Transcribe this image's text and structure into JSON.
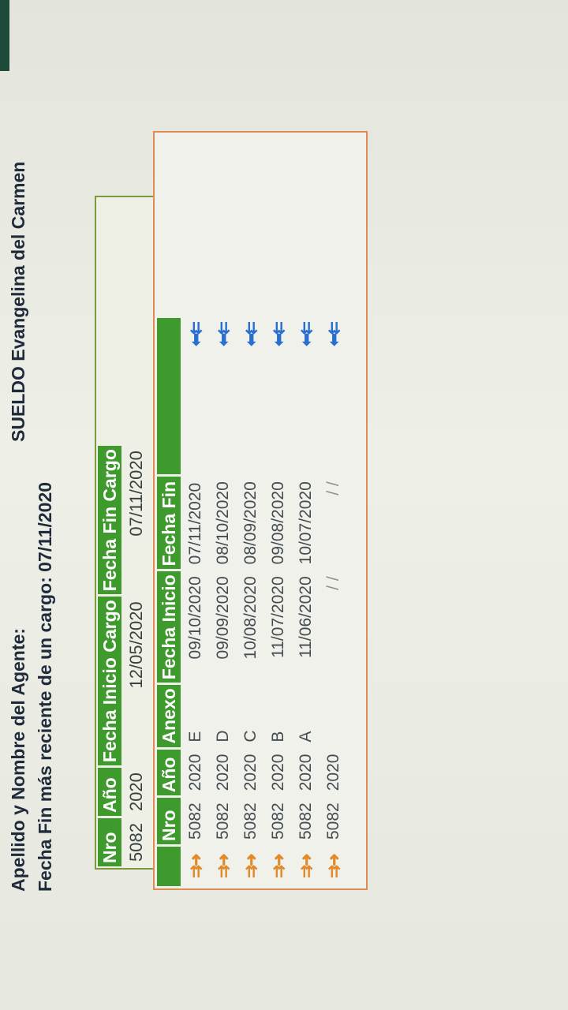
{
  "agent": {
    "name_label": "Apellido y Nombre del Agente:",
    "name_value": "SUELDO Evangelina del Carmen",
    "last_end_label": "Fecha Fin más reciente de un cargo:",
    "last_end_value": "07/11/2020"
  },
  "cargo_table": {
    "headers": [
      "Nro",
      "Año",
      "Fecha Inicio Cargo",
      "Fecha Fin Cargo"
    ],
    "row": [
      "5082",
      "2020",
      "12/05/2020",
      "07/11/2020"
    ]
  },
  "annex_table": {
    "headers": [
      "",
      "Nro",
      "Año",
      "Anexo",
      "Fecha Inicio",
      "Fecha Fin",
      ""
    ],
    "rows": [
      [
        "5082",
        "2020",
        "E",
        "09/10/2020",
        "07/11/2020"
      ],
      [
        "5082",
        "2020",
        "D",
        "09/09/2020",
        "08/10/2020"
      ],
      [
        "5082",
        "2020",
        "C",
        "10/08/2020",
        "08/09/2020"
      ],
      [
        "5082",
        "2020",
        "B",
        "11/07/2020",
        "09/08/2020"
      ],
      [
        "5082",
        "2020",
        "A",
        "11/06/2020",
        "10/07/2020"
      ],
      [
        "5082",
        "2020",
        "",
        "/ /",
        "/ /"
      ]
    ],
    "left_icon": "arrow-right-icon",
    "right_icon": "arrow-left-icon"
  },
  "colors": {
    "header_green": "#3f9a2e",
    "card_border_green": "#7c9a3a",
    "card_border_orange": "#e08a55",
    "arrow_orange": "#e08a2a",
    "arrow_blue": "#2a6fd0"
  }
}
